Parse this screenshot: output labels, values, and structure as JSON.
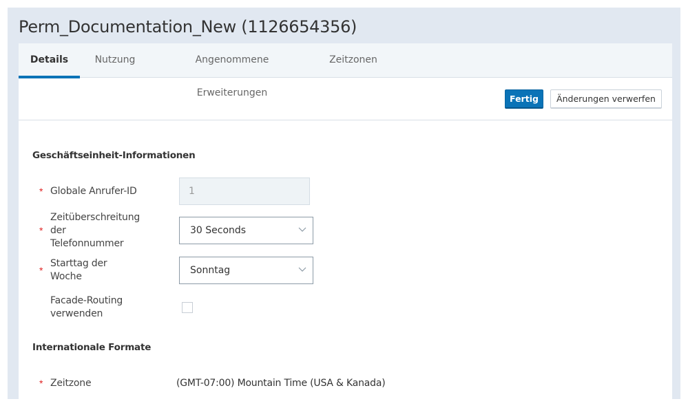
{
  "header": {
    "title": "Perm_Documentation_New (1126654356)"
  },
  "tabs": [
    {
      "label": "Details",
      "active": true
    },
    {
      "label": "Nutzung",
      "active": false
    },
    {
      "label": "Angenommene Erweiterungen",
      "active": false
    },
    {
      "label": "Zeitzonen",
      "active": false
    }
  ],
  "toolbar": {
    "done_label": "Fertig",
    "discard_label": "Änderungen verwerfen"
  },
  "sections": {
    "business_unit": {
      "title": "Geschäftseinheit-Informationen",
      "fields": {
        "global_caller_id": {
          "label": "Globale Anrufer-ID",
          "required": "*",
          "value": "1"
        },
        "phone_timeout": {
          "label_lines": [
            "Zeitüberschreitung",
            "der",
            "Telefonnummer"
          ],
          "required": "*",
          "value": "30 Seconds"
        },
        "week_start": {
          "label_lines": [
            "Starttag der",
            "Woche"
          ],
          "required": "*",
          "value": "Sonntag"
        },
        "facade_routing": {
          "label_lines": [
            "Facade-Routing",
            "verwenden"
          ],
          "checked": false
        }
      }
    },
    "international": {
      "title": "Internationale Formate",
      "fields": {
        "timezone": {
          "label": "Zeitzone",
          "required": "*",
          "value": "(GMT-07:00) Mountain Time (USA & Kanada)"
        }
      }
    }
  },
  "colors": {
    "accent": "#0a73b7",
    "frame_bg": "#e1e8f1",
    "tabbar_bg": "#f2f6f9",
    "required": "#e02424"
  }
}
